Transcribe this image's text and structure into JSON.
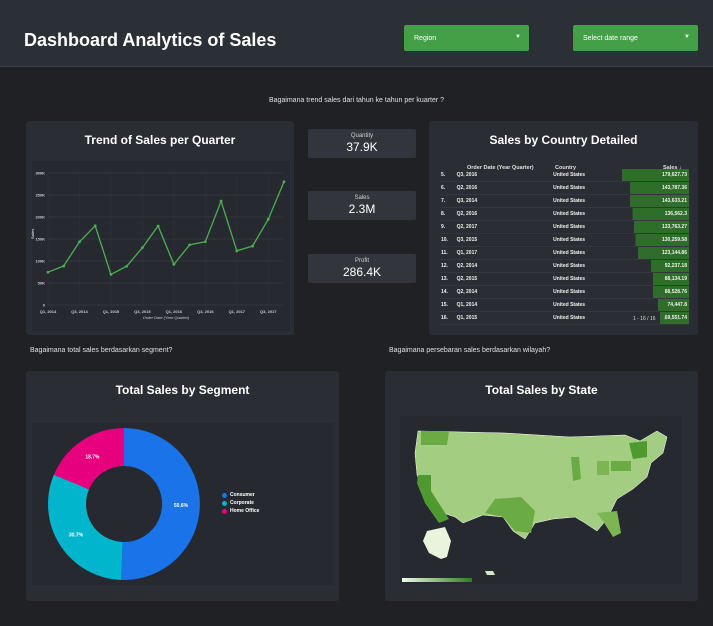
{
  "header": {
    "title": "Dashboard Analytics of Sales",
    "region_label": "Region",
    "date_label": "Select date range"
  },
  "questions": {
    "q1": "Bagaimana trend sales dari tahun ke tahun per kuarter ?",
    "q2": "Bagaimana total sales berdasarkan segment?",
    "q3": "Bagaimana persebaran sales berdasarkan wilayah?"
  },
  "kpis": [
    {
      "label": "Quantity",
      "value": "37.9K"
    },
    {
      "label": "Sales",
      "value": "2.3M"
    },
    {
      "label": "Profit",
      "value": "286.4K"
    }
  ],
  "trend": {
    "title": "Trend of Sales per Quarter",
    "xlabel": "Order Date (Year Quarter)",
    "ylabel": "Sales"
  },
  "country": {
    "title": "Sales by Country Detailed",
    "col_date": "Order Date (Year Quarter)",
    "col_country": "Country",
    "col_sales": "Sales ↓",
    "pagination": "1 - 16 / 16",
    "rows": [
      {
        "idx": "5.",
        "date": "Q3, 2016",
        "country": "United States",
        "sales": "179,627.73",
        "frac": 1.0
      },
      {
        "idx": "6.",
        "date": "Q2, 2016",
        "country": "United States",
        "sales": "143,787.36",
        "frac": 0.88
      },
      {
        "idx": "7.",
        "date": "Q3, 2014",
        "country": "United States",
        "sales": "143,633.21",
        "frac": 0.88
      },
      {
        "idx": "8.",
        "date": "Q2, 2016",
        "country": "United States",
        "sales": "136,562.3",
        "frac": 0.84
      },
      {
        "idx": "9.",
        "date": "Q2, 2017",
        "country": "United States",
        "sales": "133,763.27",
        "frac": 0.82
      },
      {
        "idx": "10.",
        "date": "Q3, 2015",
        "country": "United States",
        "sales": "130,259.58",
        "frac": 0.8
      },
      {
        "idx": "11.",
        "date": "Q1, 2017",
        "country": "United States",
        "sales": "123,144.86",
        "frac": 0.76
      },
      {
        "idx": "12.",
        "date": "Q2, 2014",
        "country": "United States",
        "sales": "92,237.18",
        "frac": 0.57
      },
      {
        "idx": "13.",
        "date": "Q2, 2015",
        "country": "United States",
        "sales": "88,134.19",
        "frac": 0.54
      },
      {
        "idx": "14.",
        "date": "Q2, 2014",
        "country": "United States",
        "sales": "88,528.76",
        "frac": 0.54
      },
      {
        "idx": "15.",
        "date": "Q1, 2014",
        "country": "United States",
        "sales": "74,447.8",
        "frac": 0.46
      },
      {
        "idx": "16.",
        "date": "Q1, 2015",
        "country": "United States",
        "sales": "69,551.74",
        "frac": 0.43
      }
    ]
  },
  "segment": {
    "title": "Total Sales by Segment"
  },
  "state": {
    "title": "Total Sales by State"
  },
  "colors": {
    "accent_green": "#43a047",
    "line_green": "#4caf50",
    "consumer": "#1a73e8",
    "corporate": "#00b5cc",
    "home_office": "#e6007e"
  },
  "chart_data": [
    {
      "type": "line",
      "title": "Trend of Sales per Quarter",
      "xlabel": "Order Date (Year Quarter)",
      "ylabel": "Sales",
      "ylim": [
        0,
        300000
      ],
      "yticks": [
        "0",
        "50K",
        "100K",
        "150K",
        "200K",
        "250K",
        "300K"
      ],
      "xtick_labels": [
        "Q1, 2014",
        "Q3, 2014",
        "Q1, 2015",
        "Q3, 2015",
        "Q1, 2016",
        "Q3, 2016",
        "Q1, 2017",
        "Q3, 2017"
      ],
      "x": [
        "Q1, 2014",
        "Q2, 2014",
        "Q3, 2014",
        "Q4, 2014",
        "Q1, 2015",
        "Q2, 2015",
        "Q3, 2015",
        "Q4, 2015",
        "Q1, 2016",
        "Q2, 2016",
        "Q3, 2016",
        "Q4, 2016",
        "Q1, 2017",
        "Q2, 2017",
        "Q3, 2017",
        "Q4, 2017"
      ],
      "values": [
        74447.8,
        88528.76,
        143633.21,
        180000,
        69551.74,
        88134.19,
        130259.58,
        179627.73,
        92237.18,
        136562.3,
        143787.36,
        236000,
        123144.86,
        133763.27,
        195000,
        280000
      ],
      "grid": true
    },
    {
      "type": "pie",
      "title": "Total Sales by Segment",
      "series": [
        {
          "name": "Consumer",
          "value": 50.6,
          "label": "50.6%"
        },
        {
          "name": "Corporate",
          "value": 30.7,
          "label": "30.7%"
        },
        {
          "name": "Home Office",
          "value": 18.7,
          "label": "18.7%"
        }
      ],
      "legend": "right"
    }
  ]
}
